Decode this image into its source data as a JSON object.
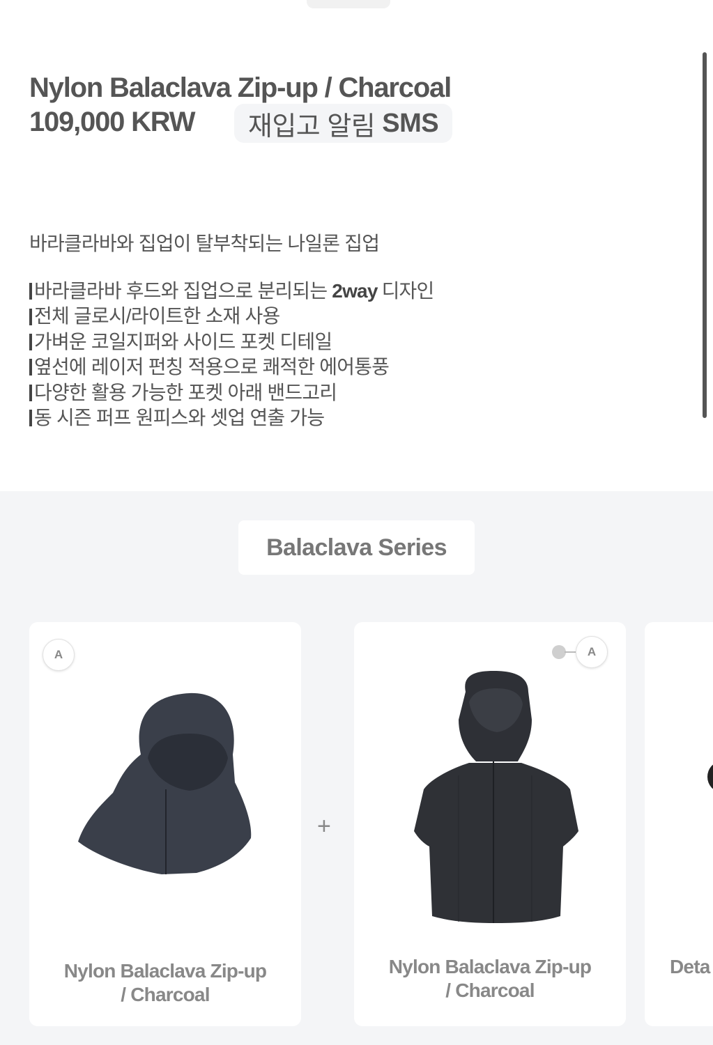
{
  "product": {
    "title": "Nylon Balaclava Zip-up / Charcoal",
    "price": "109,000 KRW",
    "restock": {
      "label_ko": "재입고 알림",
      "label_en": "SMS"
    }
  },
  "description": {
    "intro": "바라클라바와 집업이 탈부착되는 나일론 집업",
    "features": [
      {
        "pre": "바라클라바 후드와 집업으로 분리되는",
        "bold": "2way",
        "post": "디자인"
      },
      {
        "pre": "전체 글로시/라이트한 소재 사용",
        "bold": "",
        "post": ""
      },
      {
        "pre": "가벼운 코일지퍼와 사이드 포켓 디테일",
        "bold": "",
        "post": ""
      },
      {
        "pre": "옆선에 레이저 펀칭 적용으로 쾌적한 에어통풍",
        "bold": "",
        "post": ""
      },
      {
        "pre": "다양한 활용 가능한 포켓 아래 밴드고리",
        "bold": "",
        "post": ""
      },
      {
        "pre": "동 시즌 퍼프 원피스와 셋업 연출 가능",
        "bold": "",
        "post": ""
      }
    ]
  },
  "series": {
    "button_label": "Balaclava Series",
    "plus": "+",
    "cards": [
      {
        "badge": "A",
        "name_line1": "Nylon Balaclava Zip-up",
        "name_line2": "/ Charcoal"
      },
      {
        "badge": "A",
        "name_line1": "Nylon Balaclava Zip-up",
        "name_line2": "/ Charcoal"
      },
      {
        "name_line1": "Deta"
      }
    ]
  }
}
